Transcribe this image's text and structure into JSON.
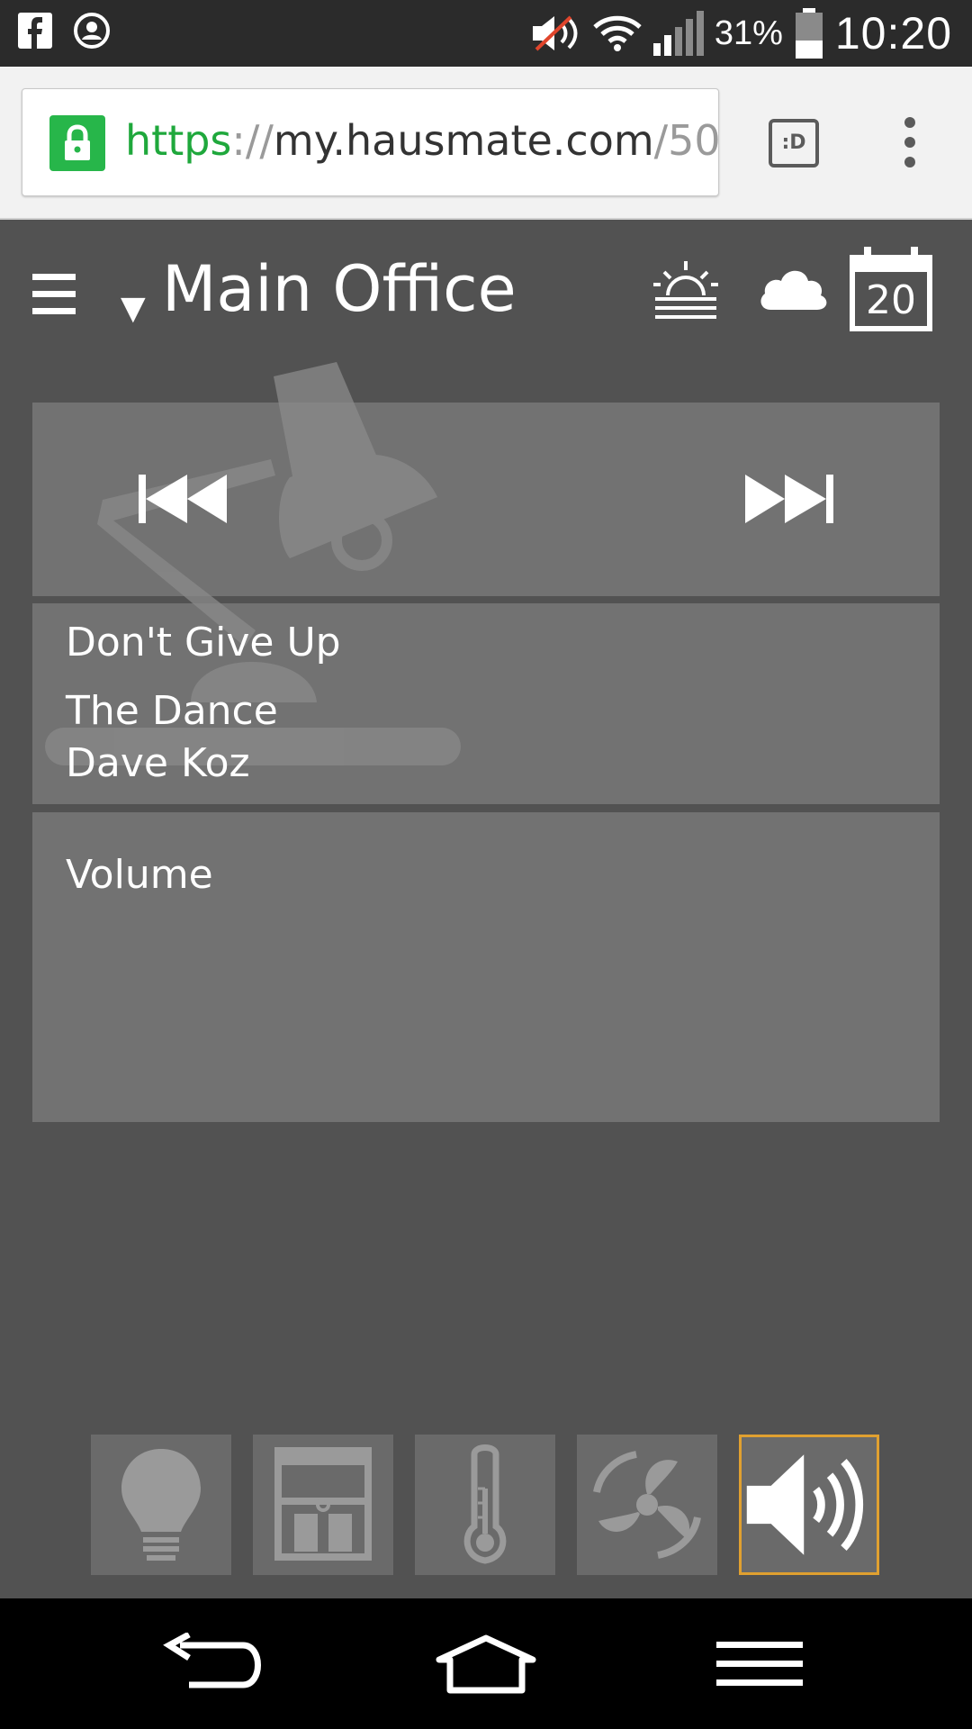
{
  "status_bar": {
    "battery_percent": "31%",
    "clock": "10:20",
    "icons": [
      "facebook-icon",
      "profile-icon",
      "muted-volume-icon",
      "wifi-icon",
      "signal-icon",
      "battery-icon"
    ]
  },
  "browser": {
    "url_scheme": "https",
    "url_separator": "://",
    "url_host": "my.hausmate.com",
    "url_path": "/50",
    "tab_switcher_label": ":D",
    "secure_color": "#27b64a"
  },
  "header": {
    "room_name": "Main Office",
    "calendar_day": "20",
    "icons": [
      "menu-icon",
      "dropdown-caret-icon",
      "sunrise-icon",
      "cloud-icon",
      "calendar-icon"
    ]
  },
  "player": {
    "controls": [
      "previous-track-icon",
      "next-track-icon"
    ],
    "track_title": "Don't Give Up",
    "album": "The Dance",
    "artist": "Dave Koz",
    "volume_label": "Volume"
  },
  "categories": {
    "items": [
      {
        "name": "lights",
        "icon": "lightbulb-icon",
        "active": false
      },
      {
        "name": "blinds",
        "icon": "window-blind-icon",
        "active": false
      },
      {
        "name": "climate",
        "icon": "thermometer-icon",
        "active": false
      },
      {
        "name": "fan",
        "icon": "fan-icon",
        "active": false
      },
      {
        "name": "audio",
        "icon": "speaker-icon",
        "active": true
      }
    ],
    "active_border_color": "#e0a030"
  },
  "nav": {
    "icons": [
      "back-icon",
      "home-icon",
      "recent-apps-icon"
    ]
  }
}
